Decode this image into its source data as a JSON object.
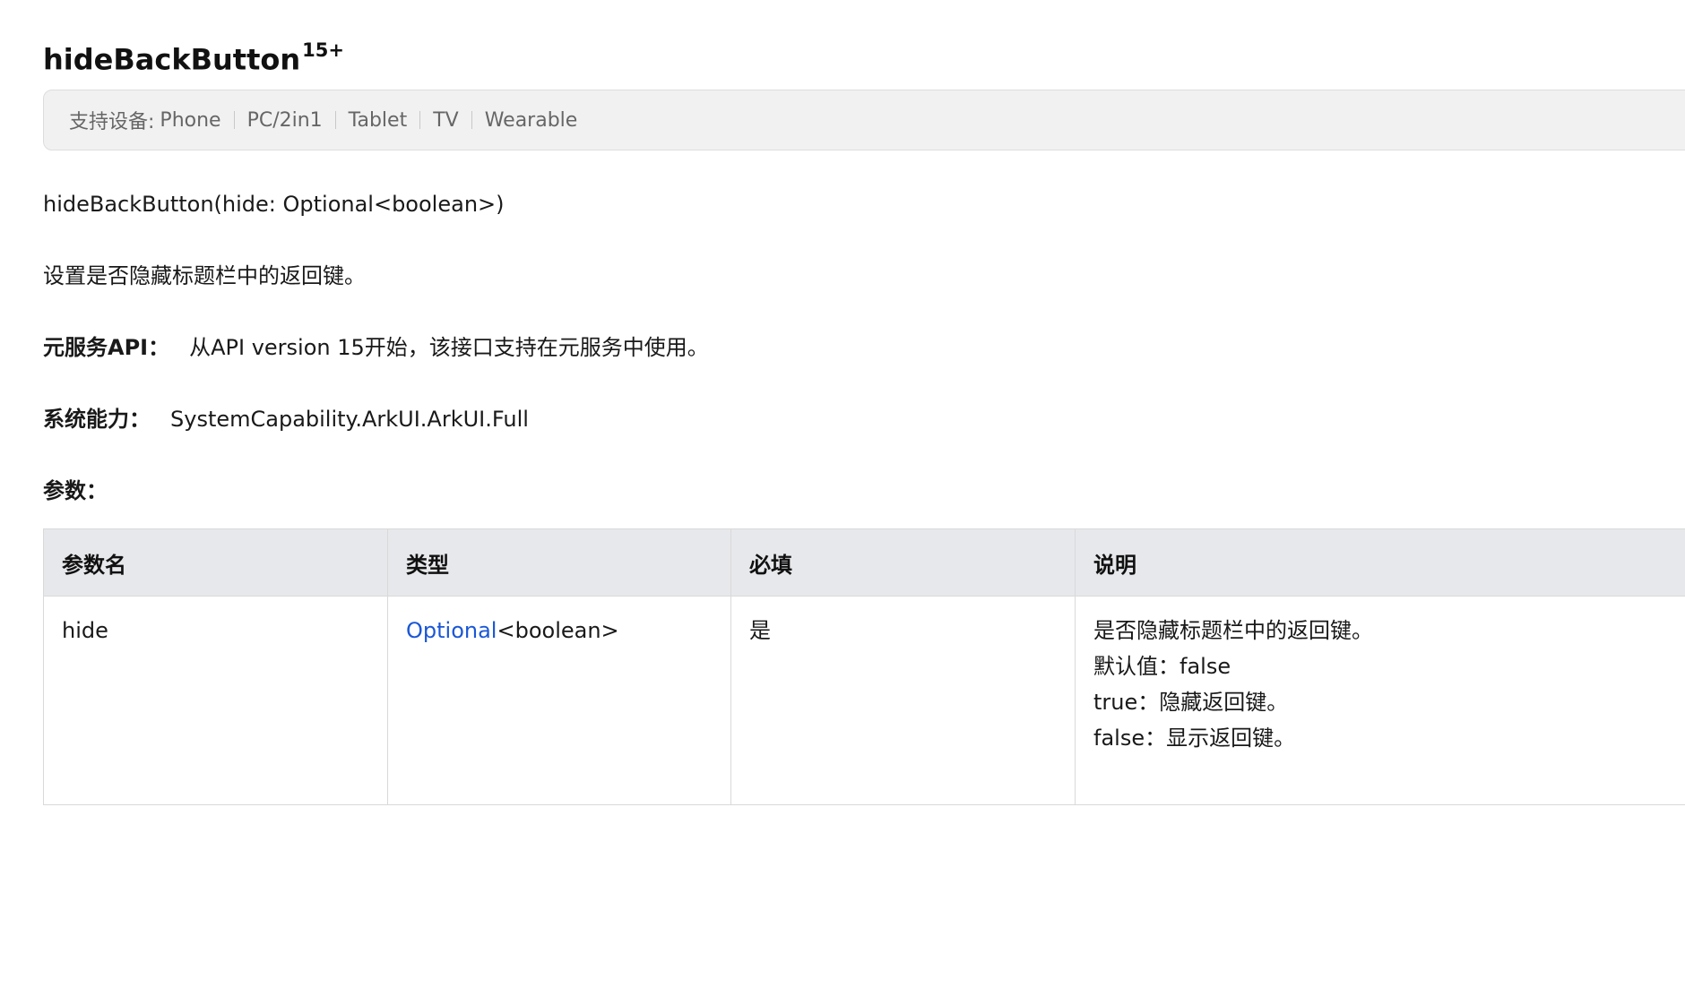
{
  "title": {
    "name": "hideBackButton",
    "version": "15+"
  },
  "devices": {
    "label": "支持设备:",
    "items": [
      "Phone",
      "PC/2in1",
      "Tablet",
      "TV",
      "Wearable"
    ]
  },
  "signature": "hideBackButton(hide: Optional<boolean>)",
  "description": "设置是否隐藏标题栏中的返回键。",
  "atomic_service": {
    "label": "元服务API：",
    "value": "从API version 15开始，该接口支持在元服务中使用。"
  },
  "system_capability": {
    "label": "系统能力：",
    "value": "SystemCapability.ArkUI.ArkUI.Full"
  },
  "params_label": "参数：",
  "param_table": {
    "headers": [
      "参数名",
      "类型",
      "必填",
      "说明"
    ],
    "rows": [
      {
        "name": "hide",
        "type_link": "Optional",
        "type_rest": "<boolean>",
        "required": "是",
        "desc_lines": [
          "是否隐藏标题栏中的返回键。",
          "默认值：false",
          "true：隐藏返回键。",
          "false：显示返回键。"
        ]
      }
    ]
  },
  "colors": {
    "link": "#1a57d6",
    "header_bg": "#e7e8eb",
    "device_bar_bg": "#f1f1f1"
  }
}
